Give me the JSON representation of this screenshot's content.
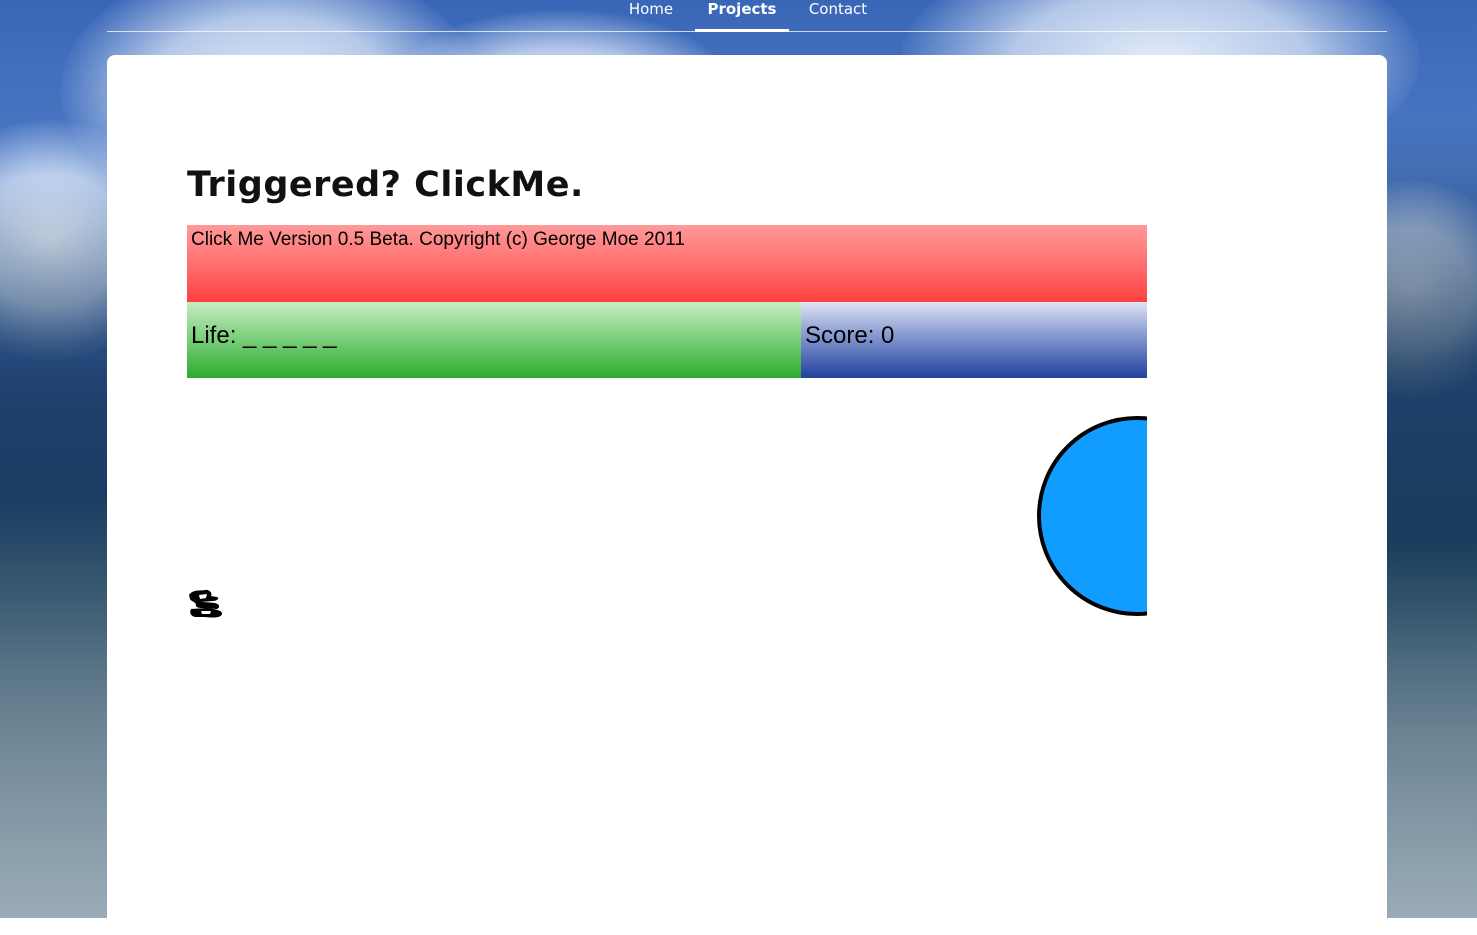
{
  "nav": {
    "items": [
      {
        "label": "Home",
        "active": false
      },
      {
        "label": "Projects",
        "active": true
      },
      {
        "label": "Contact",
        "active": false
      }
    ]
  },
  "page": {
    "title": "Triggered? ClickMe."
  },
  "game": {
    "banner_text": "Click Me Version 0.5 Beta. Copyright (c) George Moe 2011",
    "life_text": "Life: _ _ _ _ _",
    "score_text": "Score: 0",
    "colors": {
      "banner": "#ff4a4a",
      "life": "#33aa33",
      "score": "#22419e",
      "target": "#119cff"
    },
    "target_icon": "blue-circle-target",
    "cursor_icon": "scribble-sprite-icon"
  }
}
